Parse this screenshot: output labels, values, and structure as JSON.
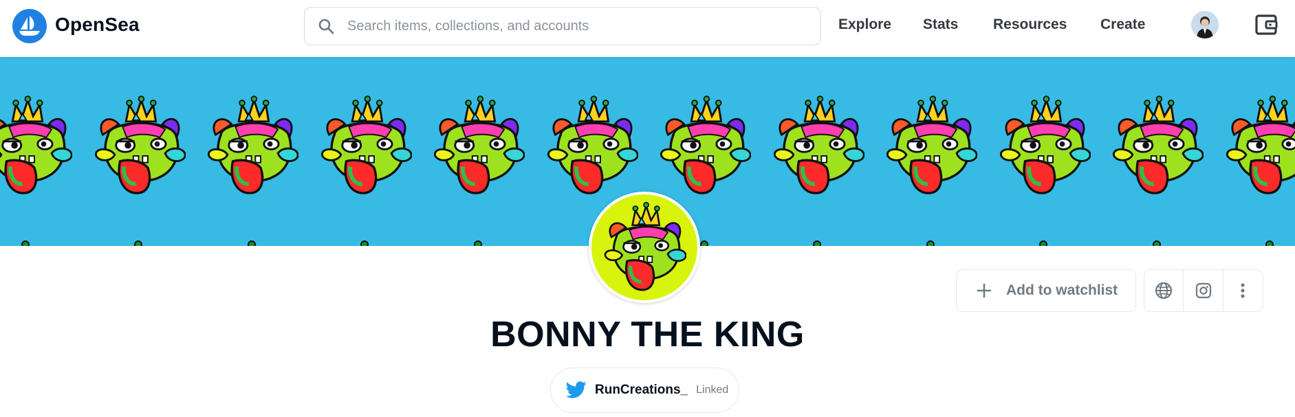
{
  "header": {
    "brand": "OpenSea",
    "search_placeholder": "Search items, collections, and accounts",
    "nav": [
      "Explore",
      "Stats",
      "Resources",
      "Create"
    ]
  },
  "collection": {
    "title": "BONNY THE KING",
    "twitter_handle": "RunCreations_",
    "twitter_status": "Linked",
    "watchlist_label": "Add to watchlist"
  },
  "colors": {
    "brand": "#2081e2",
    "banner": "#37bbe4",
    "avatar_bg": "#d8f40c",
    "twitter": "#1d9bf0"
  },
  "icons": [
    "opensea-logo",
    "search-icon",
    "avatar",
    "wallet-icon",
    "plus-icon",
    "globe-icon",
    "instagram-icon",
    "more-vertical-icon",
    "twitter-icon"
  ]
}
